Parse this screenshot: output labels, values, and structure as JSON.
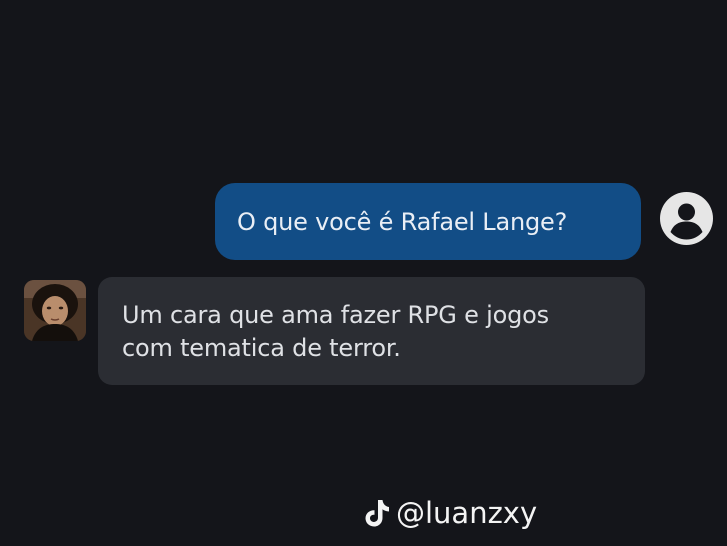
{
  "chat": {
    "user_message": "O que você é Rafael Lange?",
    "bot_reply_line1": "Um cara que ama fazer RPG e jogos",
    "bot_reply_line2": "com tematica de terror."
  },
  "watermark": {
    "handle": "@luanzxy",
    "icon": "tiktok-icon"
  },
  "icons": {
    "user_avatar": "user-circle-icon",
    "bot_avatar": "character-portrait"
  },
  "colors": {
    "background": "#14151a",
    "user_bubble": "#124d86",
    "bot_bubble": "#2b2d33",
    "text_light": "#e9eef5"
  }
}
